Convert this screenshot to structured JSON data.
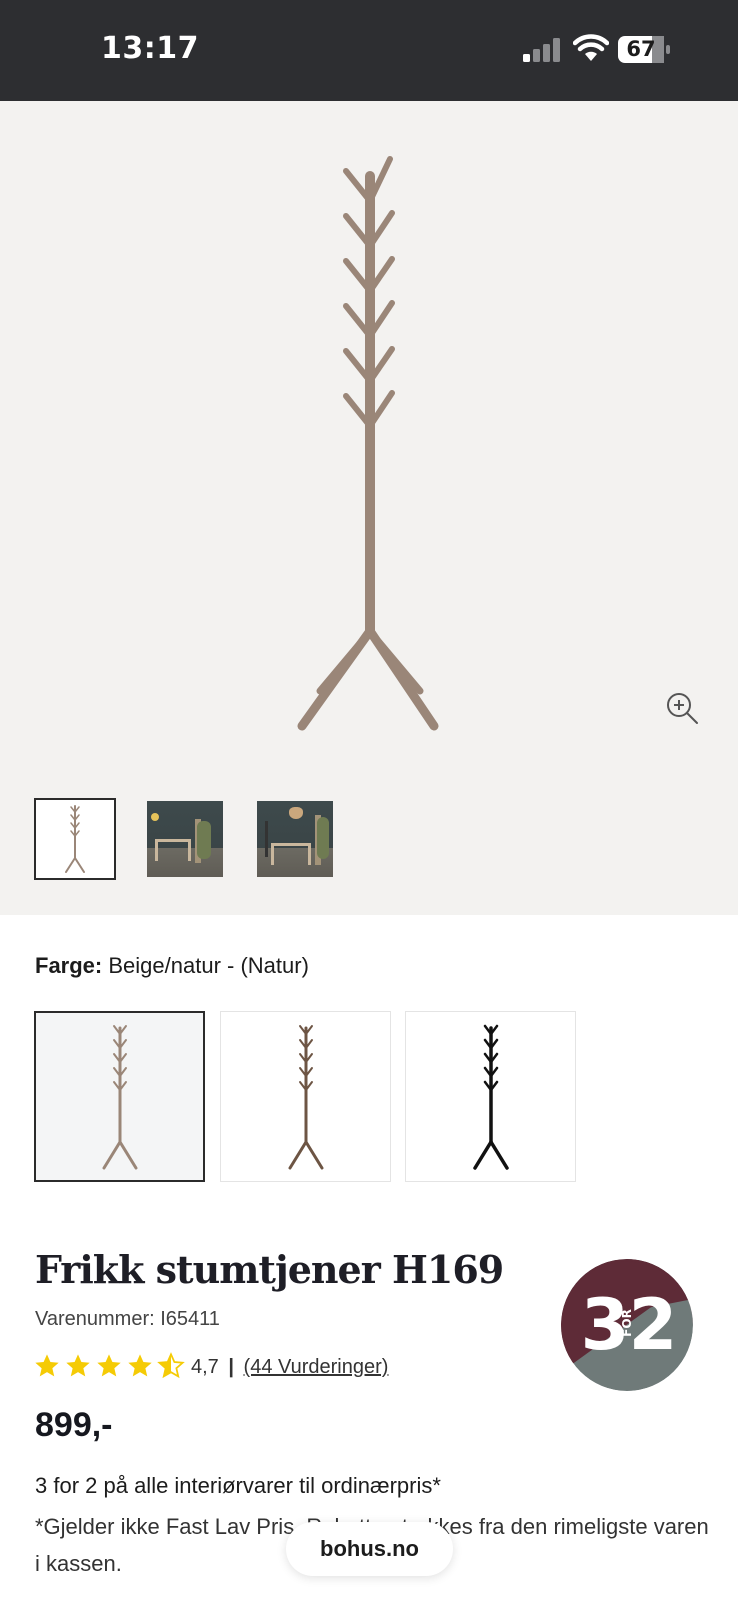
{
  "status_bar": {
    "time": "13:17",
    "battery": "67"
  },
  "product": {
    "title": "Frikk stumtjener H169",
    "sku": "Varenummer: I65411",
    "rating": {
      "value": 4.7,
      "value_text": "4,7",
      "separator": "|",
      "reviews_link": "(44 Vurderinger)"
    },
    "price": "899,-"
  },
  "color": {
    "label": "Farge:",
    "value": "Beige/natur - (Natur)",
    "swatches": [
      "natur",
      "brun",
      "sort"
    ]
  },
  "gallery": {
    "thumbnail_count": 3,
    "active_index": 0
  },
  "badge": {
    "left": "3",
    "small": "FOR",
    "right": "2",
    "colors": {
      "top": "#5e2b37",
      "bottom": "#6f7a79"
    }
  },
  "promo": {
    "title": "3 for 2 på alle interiørvarer til ordinærpris*",
    "text": "*Gjelder ikke Fast Lav Pris. Rabatten trekkes fra den rimeligste varen i kassen."
  },
  "browser": {
    "url": "bohus.no"
  },
  "colors": {
    "status_bar": "#2d2e31",
    "gallery_bg": "#f3f2f0",
    "star": "#f5cb05",
    "wood": "#9a8678"
  }
}
